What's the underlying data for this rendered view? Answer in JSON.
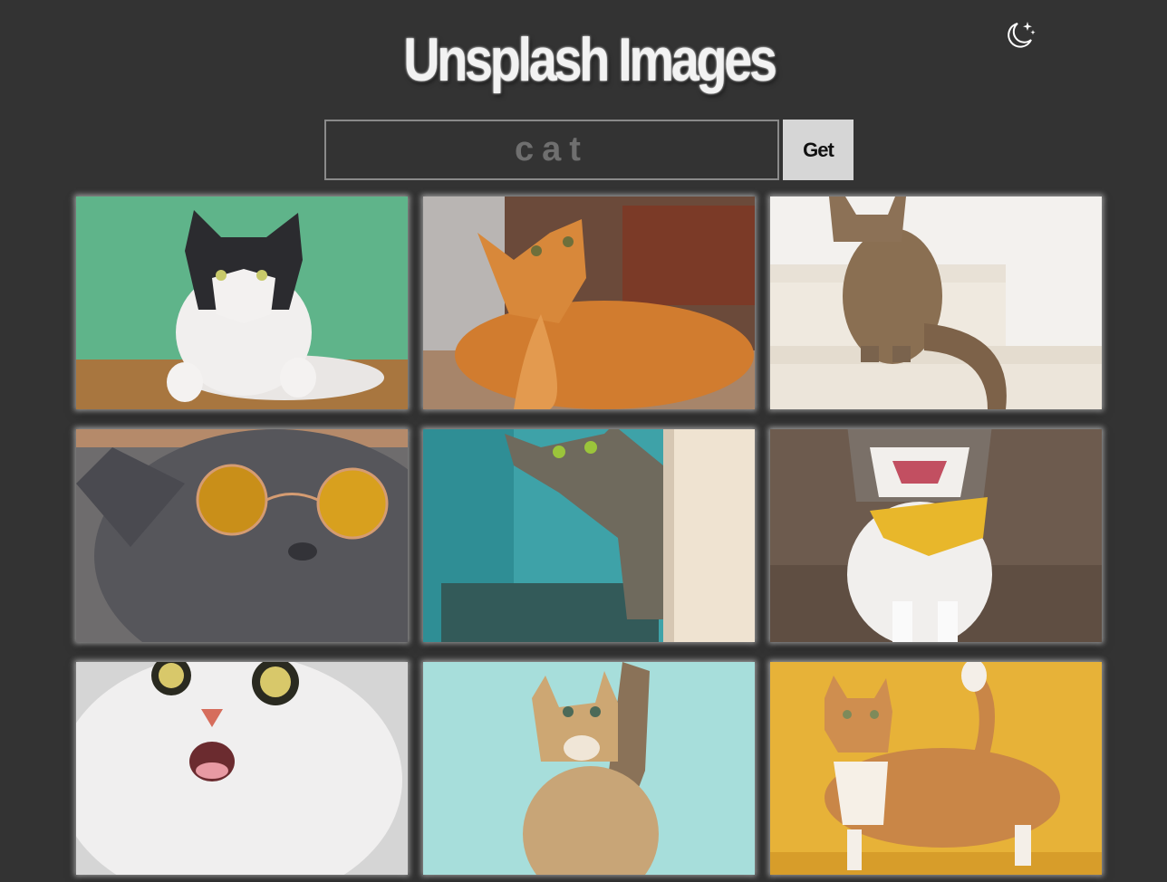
{
  "header": {
    "title": "Unsplash Images",
    "theme_toggle_icon": "moon-stars-icon"
  },
  "search": {
    "value": "cat",
    "button_label": "Get"
  },
  "gallery": {
    "images": [
      {
        "subject": "black-and-white cat on green background",
        "bg": "#5fb48a"
      },
      {
        "subject": "orange tabby cat looking up",
        "bg": "#7a4a35"
      },
      {
        "subject": "tabby cat sitting on white stairs",
        "bg": "#ece7e0"
      },
      {
        "subject": "gray cat wearing round sunglasses",
        "bg": "#6a6a6a"
      },
      {
        "subject": "tabby cat peeking around a wall",
        "bg": "#4fb7b8"
      },
      {
        "subject": "cat with yellow bandana meowing",
        "bg": "#6d5a4d"
      },
      {
        "subject": "white cat with surprised face",
        "bg": "#dedede"
      },
      {
        "subject": "kitten reaching up on mint background",
        "bg": "#a9dfdb"
      },
      {
        "subject": "orange cat on yellow background",
        "bg": "#e7b238"
      }
    ]
  },
  "colors": {
    "background": "#333333",
    "title": "#f2f2f2",
    "button_bg": "#d6d6d6"
  }
}
